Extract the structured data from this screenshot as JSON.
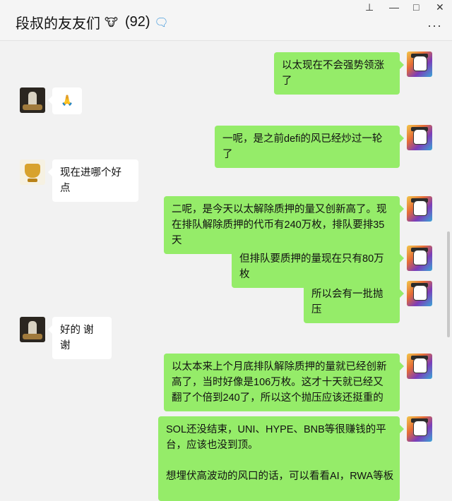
{
  "chat": {
    "title": "段叔的友友们",
    "title_emoji": "🐮",
    "member_count": "(92)",
    "bubble_icon": "speech-bubble-icon"
  },
  "window": {
    "pin": "⊥",
    "minimize": "—",
    "maximize": "□",
    "close": "✕",
    "more": "···"
  },
  "messages": [
    {
      "side": "right",
      "text": "以太现在不会强势领涨了"
    },
    {
      "side": "left",
      "text": "🙏"
    },
    {
      "side": "right",
      "text": "一呢，是之前defi的风已经炒过一轮了"
    },
    {
      "side": "left",
      "text": "现在进哪个好点"
    },
    {
      "side": "right",
      "text": "二呢，是今天以太解除质押的量又创新高了。现在排队解除质押的代币有240万枚，排队要排35天"
    },
    {
      "side": "right",
      "text": "但排队要质押的量现在只有80万枚"
    },
    {
      "side": "right",
      "text": "所以会有一批抛压"
    },
    {
      "side": "left",
      "text": "好的 谢谢"
    },
    {
      "side": "right",
      "text": "以太本来上个月底排队解除质押的量就已经创新高了，当时好像是106万枚。这才十天就已经又翻了个倍到240了，所以这个抛压应该还挺重的"
    },
    {
      "side": "right",
      "text": "SOL还没结束，UNI、HYPE、BNB等很赚钱的平台，应该也没到顶。"
    },
    {
      "side": "right",
      "text": "想埋伏高波动的风口的话，可以看看AI，RWA等板"
    }
  ]
}
